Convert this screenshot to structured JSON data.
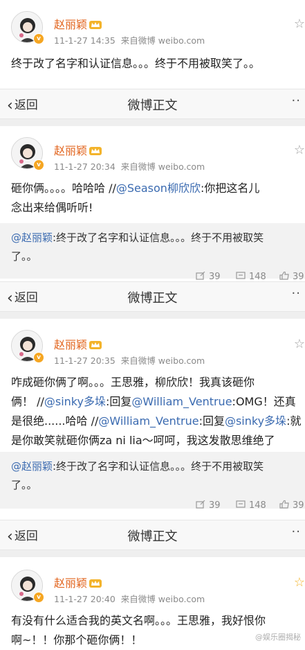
{
  "user": {
    "name": "赵丽颖",
    "verified_badge": "v"
  },
  "posts": [
    {
      "time": "11-1-27 14:35",
      "source": "来自微博 weibo.com",
      "lines": [
        "终于于改了名字和认证信息。。。终于不用被取笑了。。"
      ]
    },
    {
      "time": "11-1-27 20:34",
      "source": "来自微博 weibo.com",
      "line1_plain": "砸你俩。。。。哈哈哈 //",
      "line1_link": "@Season柳欣欣",
      "line1_tail": ":你把这名儿",
      "line2": "念出来给偶听听!",
      "retweet_user": "@赵丽颖",
      "retweet_line1": ":终于改了名字和认证信息。。。终于不用被取笑",
      "retweet_line2": "了。。",
      "stats": {
        "repost": "39",
        "comment": "148",
        "like": "39"
      }
    },
    {
      "time": "11-1-27 20:35",
      "source": "来自微博 weibo.com",
      "l1": "咋成砸你俩了啊。。。王思雅，柳欣欣！我真该砸你",
      "l2a": "俩！ //",
      "l2b": "@sinky多垛",
      "l2c": ":回复",
      "l2d": "@William_Ventrue",
      "l2e": ":OMG！还真",
      "l3a": "是很绝......哈哈 //",
      "l3b": "@William_Ventrue",
      "l3c": ":回复",
      "l3d": "@sinky多垛",
      "l3e": ":就",
      "l4": "是你敢笑就砸你俩za ni lia～呵呵，我这发散思维绝了",
      "retweet_user": "@赵丽颖",
      "retweet_line1": ":终于改了名字和认证信息。。。终于不用被取笑",
      "retweet_line2": "了。。",
      "stats": {
        "repost": "39",
        "comment": "148",
        "like": "39"
      }
    },
    {
      "time": "11-1-27 20:40",
      "source": "来自微博 weibo.com",
      "l1": "有没有什么适合我的英文名啊。。。王思雅，我好恨你",
      "l2": "啊~！！你那个砸你俩！！"
    }
  ],
  "navbar": {
    "back_label": "返回",
    "title": "微博正文",
    "more": "··"
  },
  "watermark": "@娱乐圈揭秘"
}
